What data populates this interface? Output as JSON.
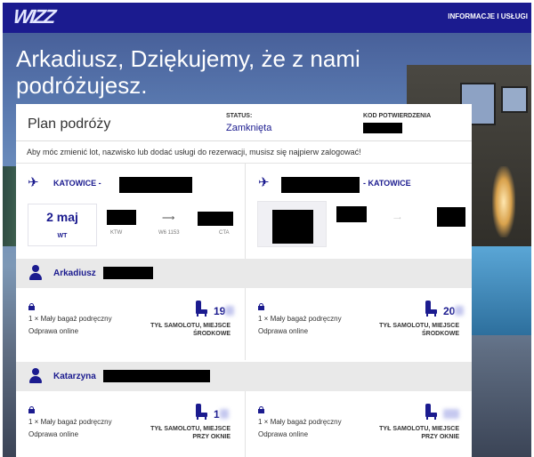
{
  "topbar": {
    "logo_text": "WIZZ",
    "info_link": "INFORMACJE I USŁUGI"
  },
  "headline": "Arkadiusz, Dziękujemy, że z nami podróżujesz.",
  "plan": {
    "title": "Plan podróży",
    "status_label": "STATUS:",
    "status_value": "Zamknięta",
    "code_label": "KOD POTWIERDZENIA"
  },
  "notice": "Aby móc zmienić lot, nazwisko lub dodać usługi do rezerwacji, musisz się najpierw zalogować!",
  "outbound": {
    "city": "KATOWICE -",
    "date": "2 maj",
    "weekday": "WT",
    "from_code": "KTW",
    "flight_no": "W6 1153",
    "to_code": "CTA"
  },
  "return": {
    "city": "- KATOWICE"
  },
  "passengers": [
    {
      "name": "Arkadiusz",
      "outbound": {
        "bag": "1 × Mały bagaż podręczny",
        "checkin": "Odprawa online",
        "seat": "19",
        "seat_desc_1": "TYŁ SAMOLOTU, MIEJSCE",
        "seat_desc_2": "ŚRODKOWE"
      },
      "return": {
        "bag": "1 × Mały bagaż podręczny",
        "checkin": "Odprawa online",
        "seat": "20",
        "seat_desc_1": "TYŁ SAMOLOTU, MIEJSCE",
        "seat_desc_2": "ŚRODKOWE"
      }
    },
    {
      "name": "Katarzyna",
      "outbound": {
        "bag": "1 × Mały bagaż podręczny",
        "checkin": "Odprawa online",
        "seat": "1",
        "seat_desc_1": "TYŁ SAMOLOTU, MIEJSCE",
        "seat_desc_2": "PRZY OKNIE"
      },
      "return": {
        "bag": "1 × Mały bagaż podręczny",
        "checkin": "Odprawa online",
        "seat": "",
        "seat_desc_1": "TYŁ SAMOLOTU, MIEJSCE",
        "seat_desc_2": "PRZY OKNIE"
      }
    }
  ],
  "icons": {
    "plane": "airplane-icon",
    "person": "person-icon",
    "lock": "lock-icon",
    "seat": "seat-icon"
  },
  "colors": {
    "brand": "#1b1b8f",
    "redaction": "#000000",
    "panel_header": "#e9e9e9"
  }
}
